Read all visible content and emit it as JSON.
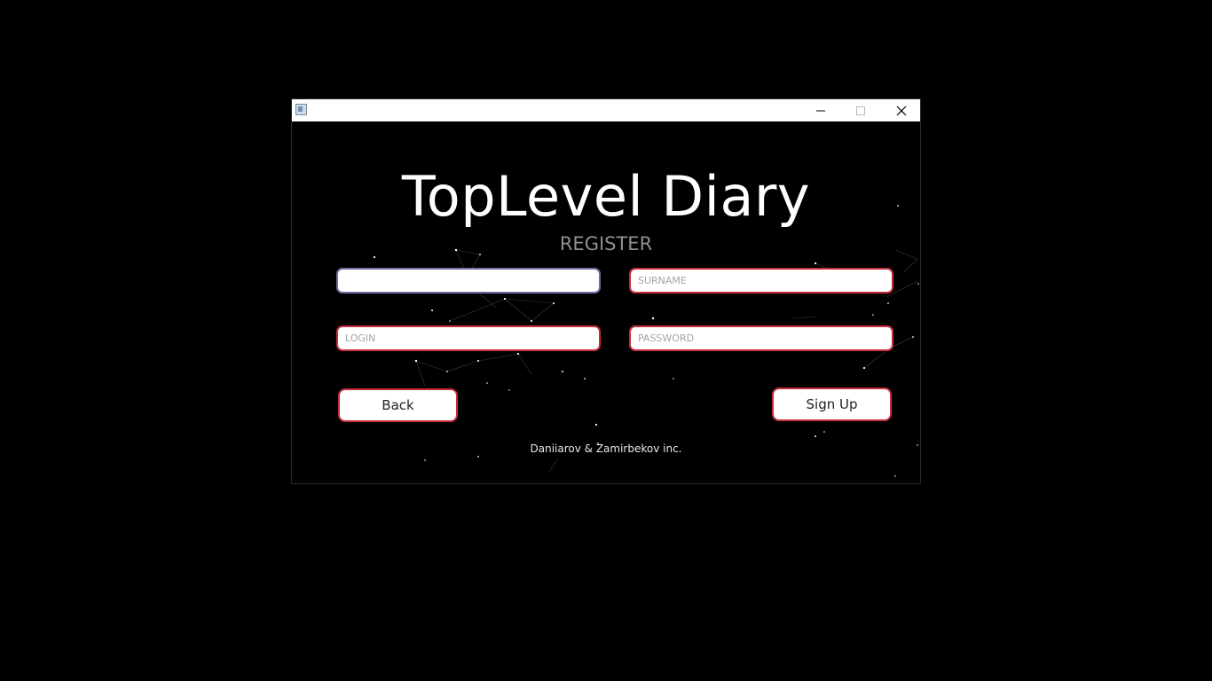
{
  "app": {
    "title": "TopLevel Diary",
    "subtitle": "REGISTER",
    "footer": "Daniiarov & Zamirbekov inc."
  },
  "titlebar": {
    "icons": [
      "app-icon",
      "minimize-icon",
      "maximize-icon",
      "close-icon"
    ]
  },
  "form": {
    "name": {
      "value": "",
      "placeholder": "",
      "focused": true
    },
    "surname": {
      "value": "",
      "placeholder": "SURNAME"
    },
    "login": {
      "value": "",
      "placeholder": "LOGIN"
    },
    "password": {
      "value": "",
      "placeholder": "PASSWORD"
    }
  },
  "buttons": {
    "back": "Back",
    "signup": "Sign Up"
  },
  "colors": {
    "background": "#000000",
    "accent_border": "#c72c3c",
    "focus_border": "#6d6ea3",
    "subtitle": "#8f8f8f"
  }
}
